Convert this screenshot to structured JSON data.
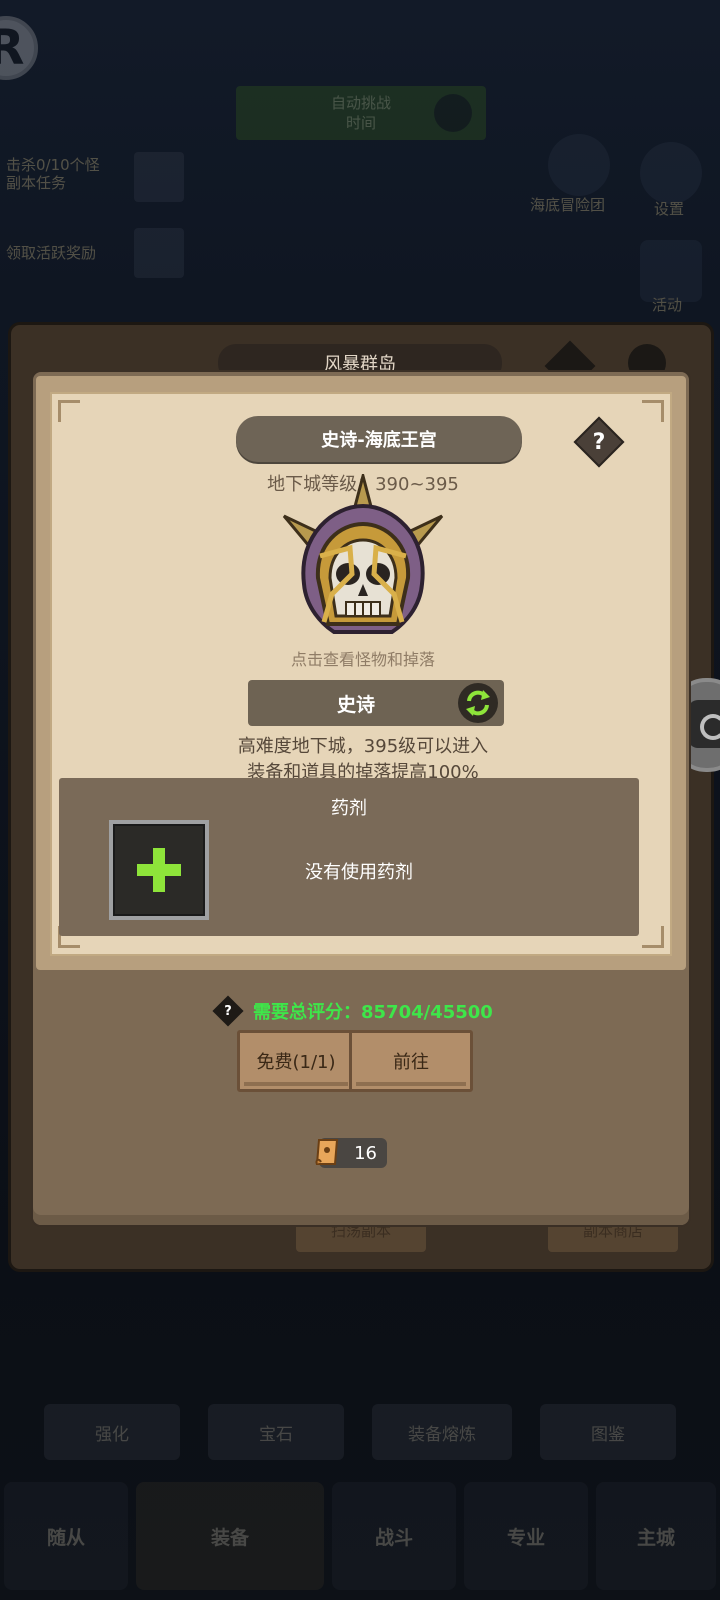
{
  "background": {
    "logo_letter": "R",
    "banner_line1": "自动挑战",
    "banner_line2": "时间",
    "quest1_line1": "击杀0/10个怪",
    "quest1_line2": "副本任务",
    "quest2": "领取活跃奖励",
    "right_icon1_label": "海底冒险团",
    "right_icon2_label": "设置",
    "right_icon3_label": "活动",
    "outer_title": "风暴群岛",
    "under_btn_left": "扫荡副本",
    "under_btn_right": "副本商店",
    "tabs": [
      "强化",
      "宝石",
      "装备熔炼",
      "图鉴"
    ],
    "nav": [
      "随从",
      "装备",
      "战斗",
      "专业",
      "主城"
    ]
  },
  "dialog": {
    "title": "史诗-海底王宫",
    "help_symbol": "?",
    "dungeon_level": "地下城等级：390~395",
    "boss_icon": "skull-helmet-boss-icon",
    "boss_hint": "点击查看怪物和掉落",
    "difficulty_label": "史诗",
    "desc_line1": "高难度地下城，395级可以进入",
    "desc_line2": "装备和道具的掉落提高100%",
    "potion": {
      "title": "药剂",
      "empty_text": "没有使用药剂"
    },
    "score": {
      "help_symbol": "?",
      "text": "需要总评分：85704/45500",
      "color": "#3ee64a"
    },
    "buttons": {
      "free_label": "免费(1/1)",
      "go_label": "前往"
    },
    "scroll_count": "16"
  },
  "colors": {
    "parchment": "#e6d5b8",
    "frame": "#7d6a54",
    "accent_green": "#8ee43a"
  }
}
